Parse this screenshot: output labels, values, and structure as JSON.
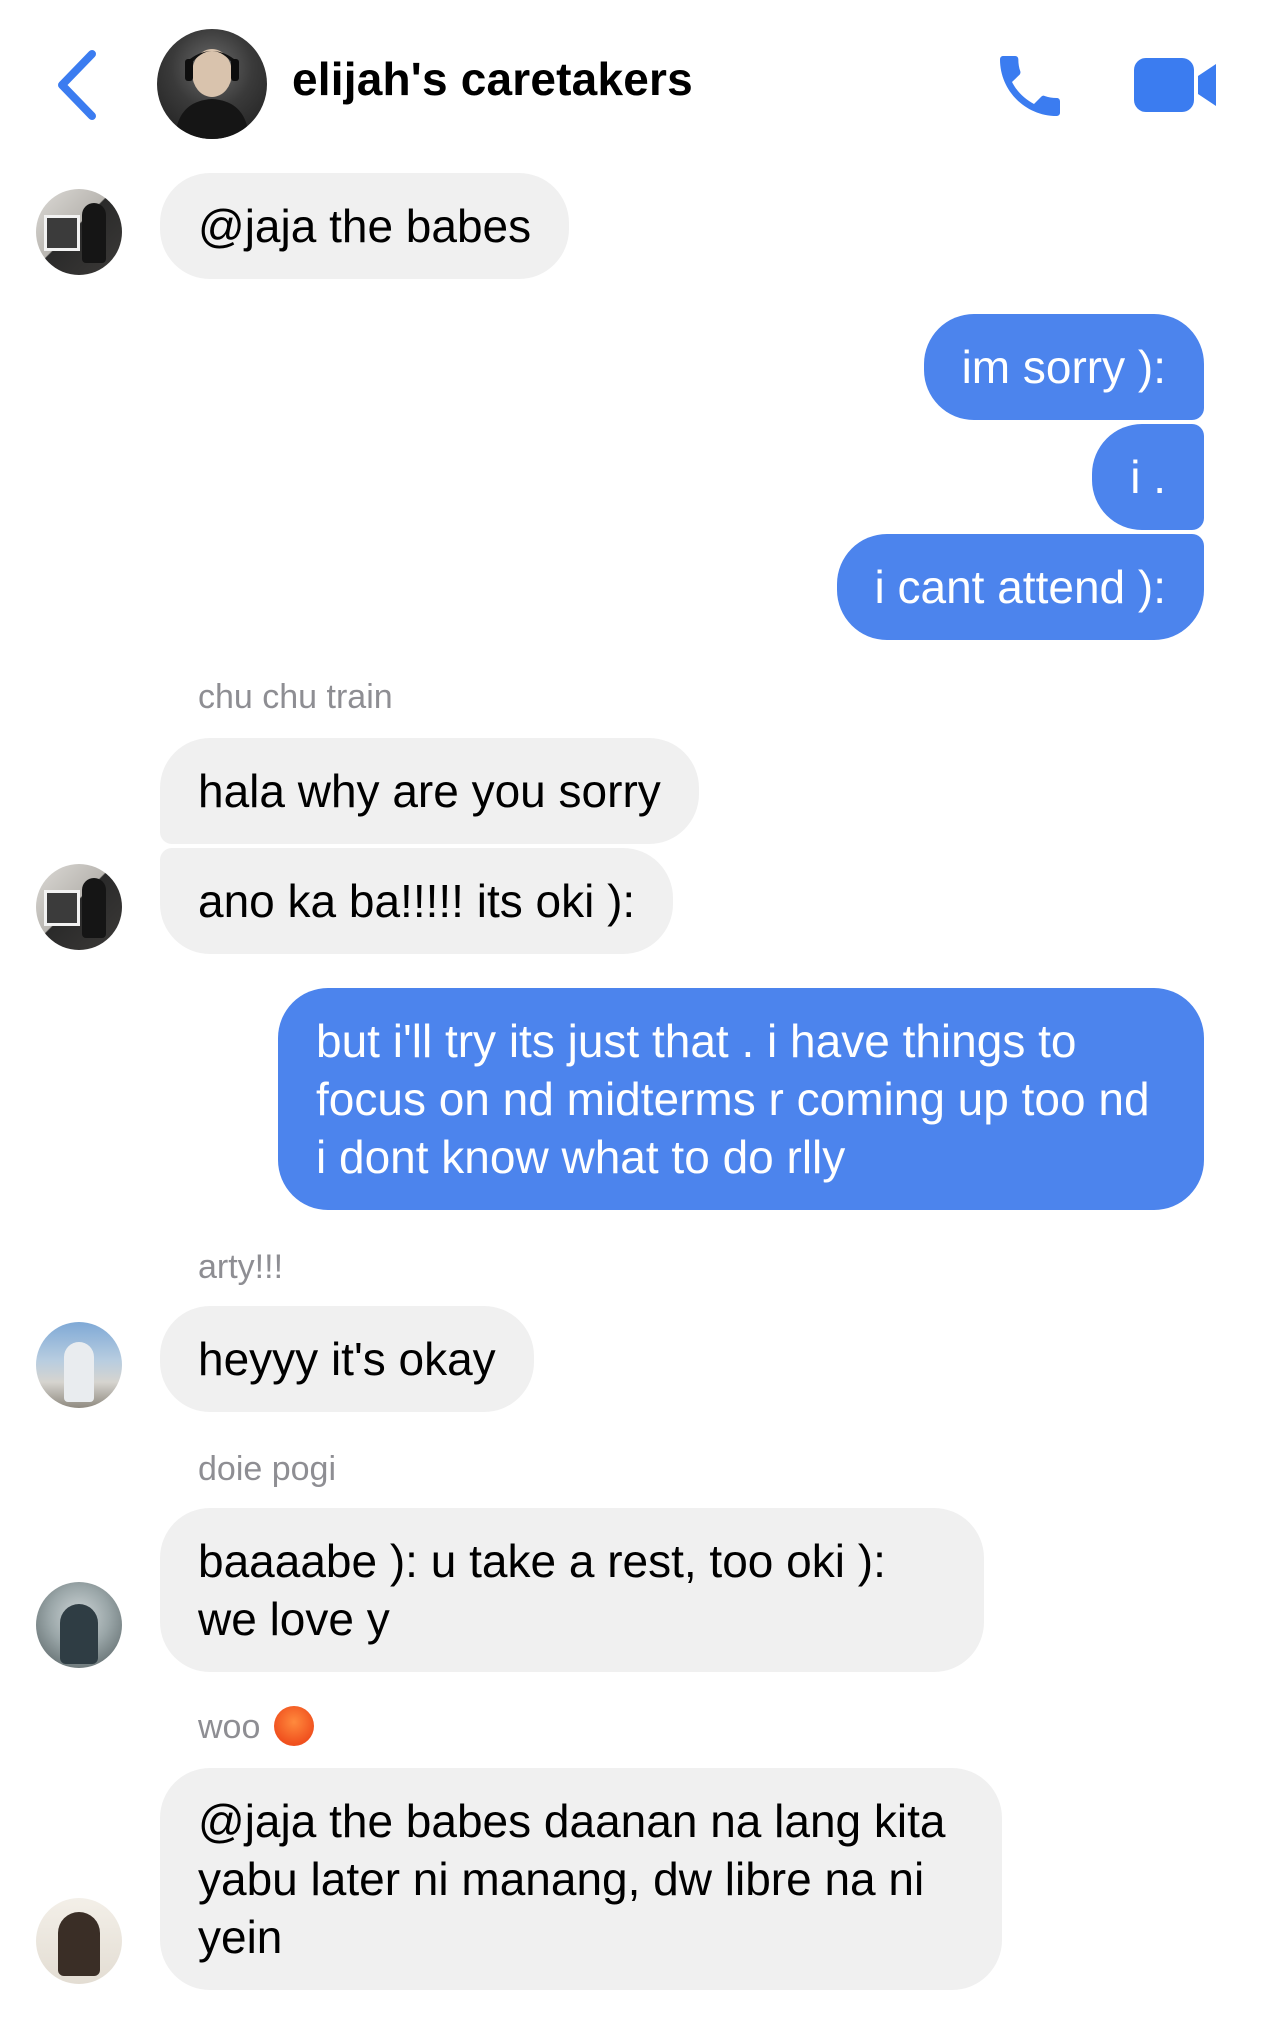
{
  "header": {
    "title": "elijah's caretakers",
    "back_icon": "chevron-left-icon",
    "call_icon": "phone-icon",
    "video_icon": "video-camera-icon",
    "accent_color": "#3b7cf0"
  },
  "messages": [
    {
      "text": "@jaja the babes"
    },
    {
      "text": "im sorry ):"
    },
    {
      "text": "i ."
    },
    {
      "text": "i cant attend ):"
    },
    {
      "sender": "chu chu train"
    },
    {
      "text": "hala why are you sorry"
    },
    {
      "text": "ano ka ba!!!!! its oki ):"
    },
    {
      "text": "but i'll try its just that . i have things to focus on nd midterms r coming up too nd i dont know what to do rlly"
    },
    {
      "sender": "arty!!!"
    },
    {
      "text": "heyyy it's okay"
    },
    {
      "sender": "doie pogi"
    },
    {
      "text": "baaaabe ): u take a rest, too oki ): we love y"
    },
    {
      "sender": "woo"
    },
    {
      "text": "@jaja the babes daanan na lang kita yabu later ni manang, dw libre na ni yein"
    }
  ],
  "colors": {
    "outgoing_bubble": "#4c84ed",
    "incoming_bubble": "#f0f0f0",
    "sender_name": "#8e8e93"
  }
}
